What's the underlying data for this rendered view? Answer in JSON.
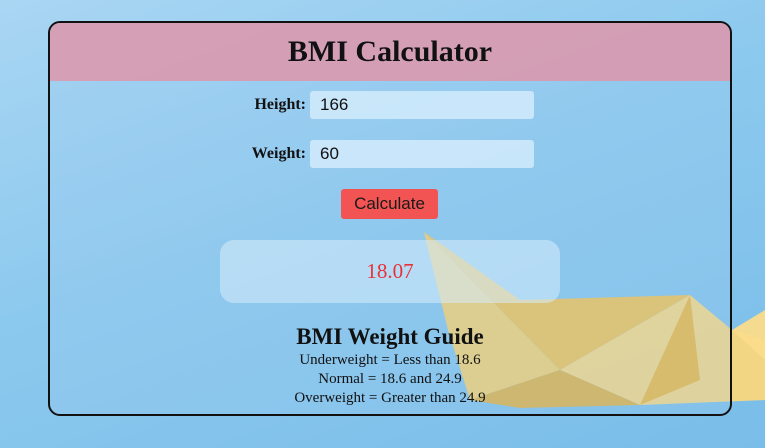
{
  "header": {
    "title": "BMI Calculator"
  },
  "form": {
    "height_label": "Height:",
    "height_value": "166",
    "weight_label": "Weight:",
    "weight_value": "60",
    "calculate_label": "Calculate"
  },
  "result": {
    "value": "18.07",
    "color": "#e8323a"
  },
  "guide": {
    "title": "BMI Weight Guide",
    "lines": [
      "Underweight = Less than 18.6",
      "Normal = 18.6 and 24.9",
      "Overweight = Greater than 24.9"
    ]
  },
  "colors": {
    "header_bg": "#d796aa",
    "button_bg": "#f25454",
    "page_bg": "#8cc9ee"
  },
  "background_image": "paper-boat"
}
